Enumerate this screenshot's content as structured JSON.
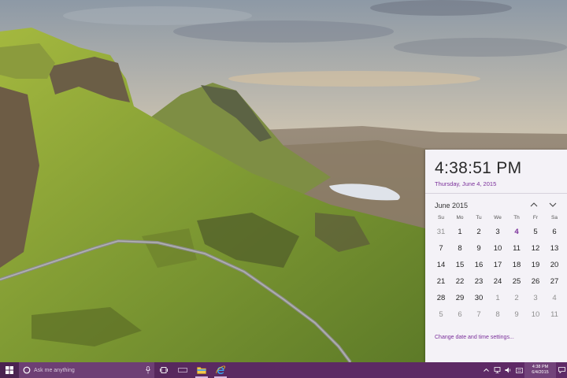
{
  "flyout": {
    "time": "4:38:51 PM",
    "date": "Thursday, June 4, 2015",
    "month_label": "June 2015",
    "weekdays": [
      "Su",
      "Mo",
      "Tu",
      "We",
      "Th",
      "Fr",
      "Sa"
    ],
    "weeks": [
      [
        "31",
        "1",
        "2",
        "3",
        "4",
        "5",
        "6"
      ],
      [
        "7",
        "8",
        "9",
        "10",
        "11",
        "12",
        "13"
      ],
      [
        "14",
        "15",
        "16",
        "17",
        "18",
        "19",
        "20"
      ],
      [
        "21",
        "22",
        "23",
        "24",
        "25",
        "26",
        "27"
      ],
      [
        "28",
        "29",
        "30",
        "1",
        "2",
        "3",
        "4"
      ],
      [
        "5",
        "6",
        "7",
        "8",
        "9",
        "10",
        "11"
      ]
    ],
    "settings_link": "Change date and time settings...",
    "accent_color": "#7a2f9a"
  },
  "taskbar": {
    "search_placeholder": "Ask me anything",
    "clock_time": "4:38 PM",
    "clock_date": "6/4/2015",
    "color": "#5b2a62"
  },
  "icons": {
    "start": "windows-logo-icon",
    "cortana": "cortana-circle-icon",
    "mic": "microphone-icon",
    "task_view": "task-view-icon",
    "file_explorer": "folder-icon",
    "edge": "internet-explorer-icon",
    "tray_up": "chevron-up-icon",
    "network": "network-icon",
    "volume": "volume-icon",
    "action_center": "message-icon"
  }
}
